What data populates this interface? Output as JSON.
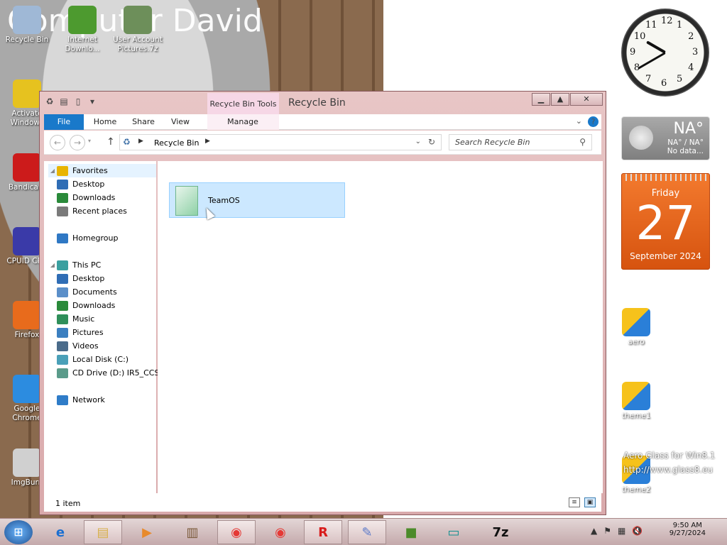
{
  "desktop": {
    "title": "Computer David",
    "icons_left": [
      {
        "label": "Recycle Bin",
        "icon": "recycle-bin-icon"
      },
      {
        "label": "Internet Downlo...",
        "icon": "download-manager-icon"
      },
      {
        "label": "User Account Pictures.7z",
        "icon": "archive-icon"
      },
      {
        "label": "Activate Windows",
        "icon": "key-icon"
      },
      {
        "label": "Bandicam",
        "icon": "record-icon"
      },
      {
        "label": "CPUID CPU",
        "icon": "chip-icon"
      },
      {
        "label": "Firefox",
        "icon": "firefox-icon"
      },
      {
        "label": "Google Chrome",
        "icon": "chrome-icon"
      },
      {
        "label": "ImgBurn",
        "icon": "disc-burn-icon"
      }
    ],
    "icons_right": [
      {
        "label": "aero",
        "icon": "theme-icon"
      },
      {
        "label": "theme1",
        "icon": "theme-icon"
      },
      {
        "label": "theme2",
        "icon": "theme-icon"
      }
    ],
    "watermark_line1": "Aero Glass for Win8.1",
    "watermark_line2": "http://www.glass8.eu"
  },
  "gadgets": {
    "clock_numbers": [
      "12",
      "1",
      "2",
      "3",
      "4",
      "5",
      "6",
      "7",
      "8",
      "9",
      "10",
      "11"
    ],
    "weather": {
      "temp": "NA°",
      "range": "NA° / NA°",
      "status": "No data..."
    },
    "calendar": {
      "weekday": "Friday",
      "day": "27",
      "month_year": "September 2024"
    }
  },
  "window": {
    "title": "Recycle Bin",
    "context_tab_group": "Recycle Bin Tools",
    "ribbon_tabs": [
      "File",
      "Home",
      "Share",
      "View",
      "Manage"
    ],
    "caption_buttons": {
      "minimize": "▁",
      "maximize": "▲",
      "close": "✕"
    },
    "address": {
      "crumb": "Recycle Bin"
    },
    "search": {
      "placeholder": "Search Recycle Bin"
    },
    "nav_tree": [
      {
        "label": "Favorites",
        "icon": "star-icon",
        "level": 0
      },
      {
        "label": "Desktop",
        "icon": "desktop-icon",
        "level": 1
      },
      {
        "label": "Downloads",
        "icon": "download-icon",
        "level": 1
      },
      {
        "label": "Recent places",
        "icon": "recent-places-icon",
        "level": 1
      },
      {
        "label": "Homegroup",
        "icon": "homegroup-icon",
        "level": 0
      },
      {
        "label": "This PC",
        "icon": "computer-icon",
        "level": 0
      },
      {
        "label": "Desktop",
        "icon": "desktop-icon",
        "level": 1
      },
      {
        "label": "Documents",
        "icon": "documents-icon",
        "level": 1
      },
      {
        "label": "Downloads",
        "icon": "download-icon",
        "level": 1
      },
      {
        "label": "Music",
        "icon": "music-icon",
        "level": 1
      },
      {
        "label": "Pictures",
        "icon": "pictures-icon",
        "level": 1
      },
      {
        "label": "Videos",
        "icon": "videos-icon",
        "level": 1
      },
      {
        "label": "Local Disk (C:)",
        "icon": "drive-icon",
        "level": 1
      },
      {
        "label": "CD Drive (D:) IR5_CCS",
        "icon": "cd-drive-icon",
        "level": 1
      },
      {
        "label": "Network",
        "icon": "network-icon",
        "level": 0
      }
    ],
    "items": [
      {
        "name": "TeamOS",
        "icon": "folder-icon"
      }
    ],
    "status": {
      "count": "1 item"
    }
  },
  "taskbar": {
    "apps": [
      {
        "name": "internet-explorer",
        "glyph": "e"
      },
      {
        "name": "file-explorer",
        "glyph": "▤"
      },
      {
        "name": "media-player",
        "glyph": "▶"
      },
      {
        "name": "archiver",
        "glyph": "▥"
      },
      {
        "name": "chrome",
        "glyph": "◉"
      },
      {
        "name": "chrome-alt",
        "glyph": "◉"
      },
      {
        "name": "roblox",
        "glyph": "R"
      },
      {
        "name": "paint",
        "glyph": "✎"
      },
      {
        "name": "minecraft",
        "glyph": "■"
      },
      {
        "name": "display",
        "glyph": "▭"
      },
      {
        "name": "7zip",
        "glyph": "7z"
      }
    ],
    "time": "9:50 AM",
    "date": "9/27/2024"
  }
}
